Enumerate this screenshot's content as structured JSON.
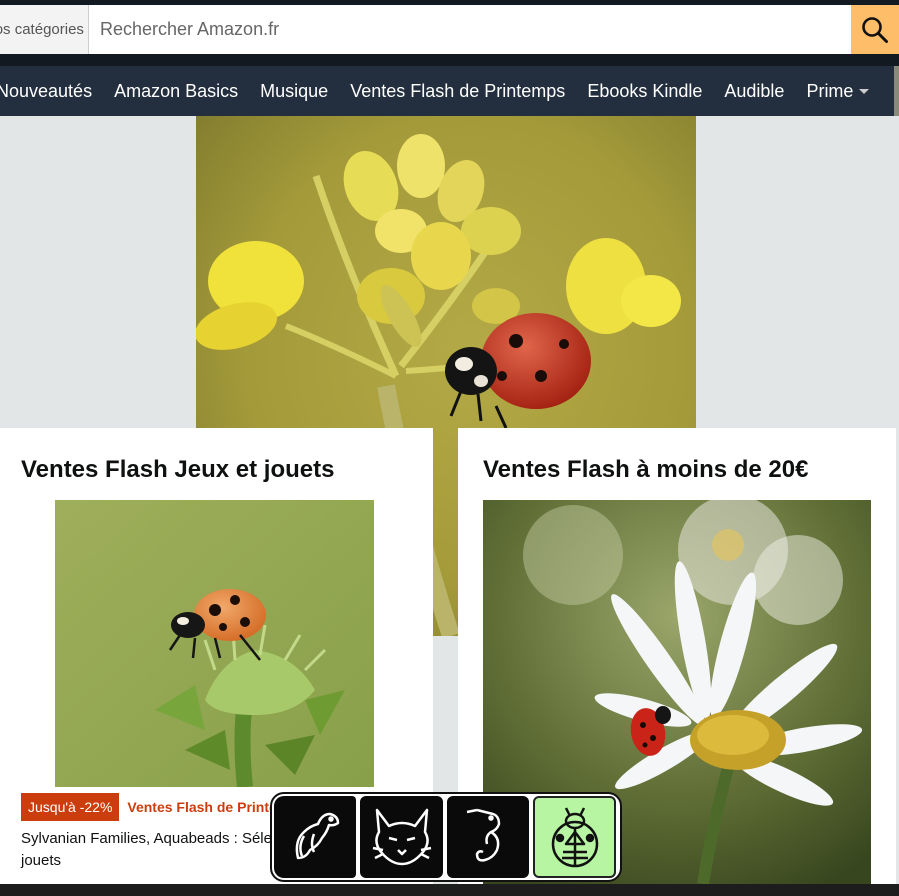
{
  "header": {
    "category_label": "Toutes nos catégories",
    "search_placeholder": "Rechercher Amazon.fr"
  },
  "nav": {
    "items": [
      "Nouveautés",
      "Amazon Basics",
      "Musique",
      "Ventes Flash de Printemps",
      "Ebooks Kindle",
      "Audible",
      "Prime"
    ]
  },
  "cards": [
    {
      "title": "Ventes Flash Jeux et jouets",
      "badge": "Jusqu'à -22%",
      "deal_label": "Ventes Flash de Printemps",
      "description": "Sylvanian Families, Aquabeads : Sélection de jeux et jouets"
    },
    {
      "title": "Ventes Flash à moins de 20€"
    }
  ],
  "icon_bar": {
    "icons": [
      "vulture-icon",
      "lynx-icon",
      "seahorse-icon",
      "ladybug-icon"
    ]
  },
  "colors": {
    "nav_bg": "#232f3e",
    "search_button": "#febd69",
    "deal_badge": "#cc3d0d"
  }
}
